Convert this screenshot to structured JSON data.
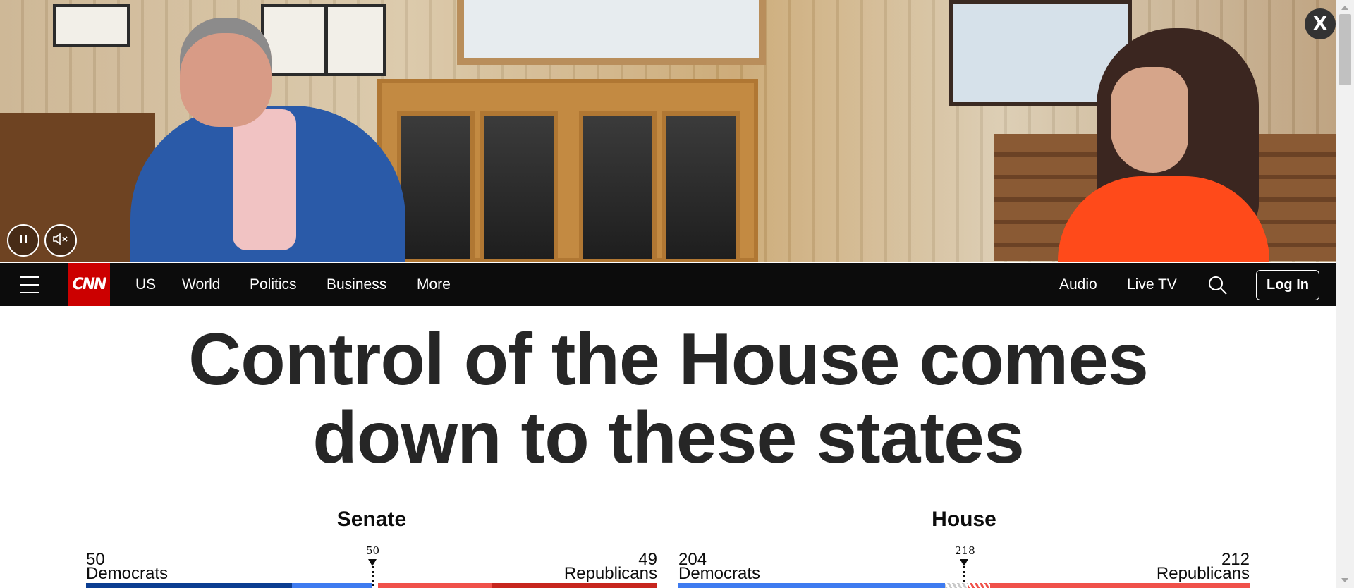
{
  "video": {
    "close_label": "X",
    "pause_icon": "pause-icon",
    "mute_icon": "muted-speaker-icon"
  },
  "nav": {
    "logo": "CNN",
    "links": [
      "US",
      "World",
      "Politics",
      "Business",
      "More"
    ],
    "right_links": [
      "Audio",
      "Live TV"
    ],
    "search_icon": "search-icon",
    "login_label": "Log In"
  },
  "headline": {
    "line1": "Control of the House comes",
    "line2": "down to these states"
  },
  "senate": {
    "title": "Senate",
    "majority": "50",
    "dem_count": "50",
    "dem_label": "Democrats",
    "rep_count": "49",
    "rep_label": "Republicans",
    "winner": "Democrats"
  },
  "house": {
    "title": "House",
    "majority": "218",
    "dem_count": "204",
    "dem_label": "Democrats",
    "rep_count": "212",
    "rep_label": "Republicans"
  },
  "colors": {
    "cnn_red": "#cc0000",
    "dem_dark": "#0b3d91",
    "dem_light": "#3e7bf0",
    "rep_dark": "#c7261e",
    "rep_light": "#f0514a",
    "nav_bg": "#0c0c0c"
  }
}
